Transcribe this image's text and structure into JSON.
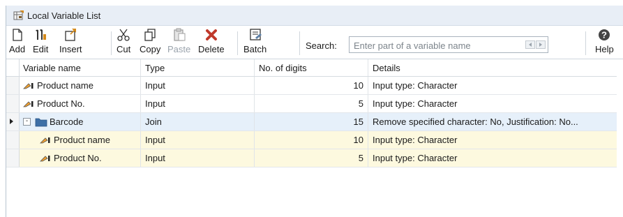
{
  "window": {
    "title": "Local Variable List"
  },
  "toolbar": {
    "add": "Add",
    "edit": "Edit",
    "insert": "Insert",
    "cut": "Cut",
    "copy": "Copy",
    "paste": "Paste",
    "delete": "Delete",
    "batch": "Batch",
    "help": "Help",
    "search_label": "Search:",
    "search_placeholder": "Enter part of a variable name"
  },
  "grid": {
    "columns": [
      "Variable name",
      "Type",
      "No. of digits",
      "Details"
    ],
    "rows": [
      {
        "name": "Product name",
        "type": "Input",
        "digits": "10",
        "details": "Input type: Character"
      },
      {
        "name": "Product No.",
        "type": "Input",
        "digits": "5",
        "details": "Input type: Character"
      },
      {
        "name": "Barcode",
        "type": "Join",
        "digits": "15",
        "details": "Remove specified character: No, Justification: No...",
        "expander": "-"
      },
      {
        "name": "Product name",
        "type": "Input",
        "digits": "10",
        "details": "Input type: Character"
      },
      {
        "name": "Product No.",
        "type": "Input",
        "digits": "5",
        "details": "Input type: Character"
      }
    ]
  },
  "colors": {
    "selected_row": "#e6f0fa",
    "child_row": "#fdf9df",
    "delete_icon": "#c0392b",
    "help_icon": "#444444"
  }
}
